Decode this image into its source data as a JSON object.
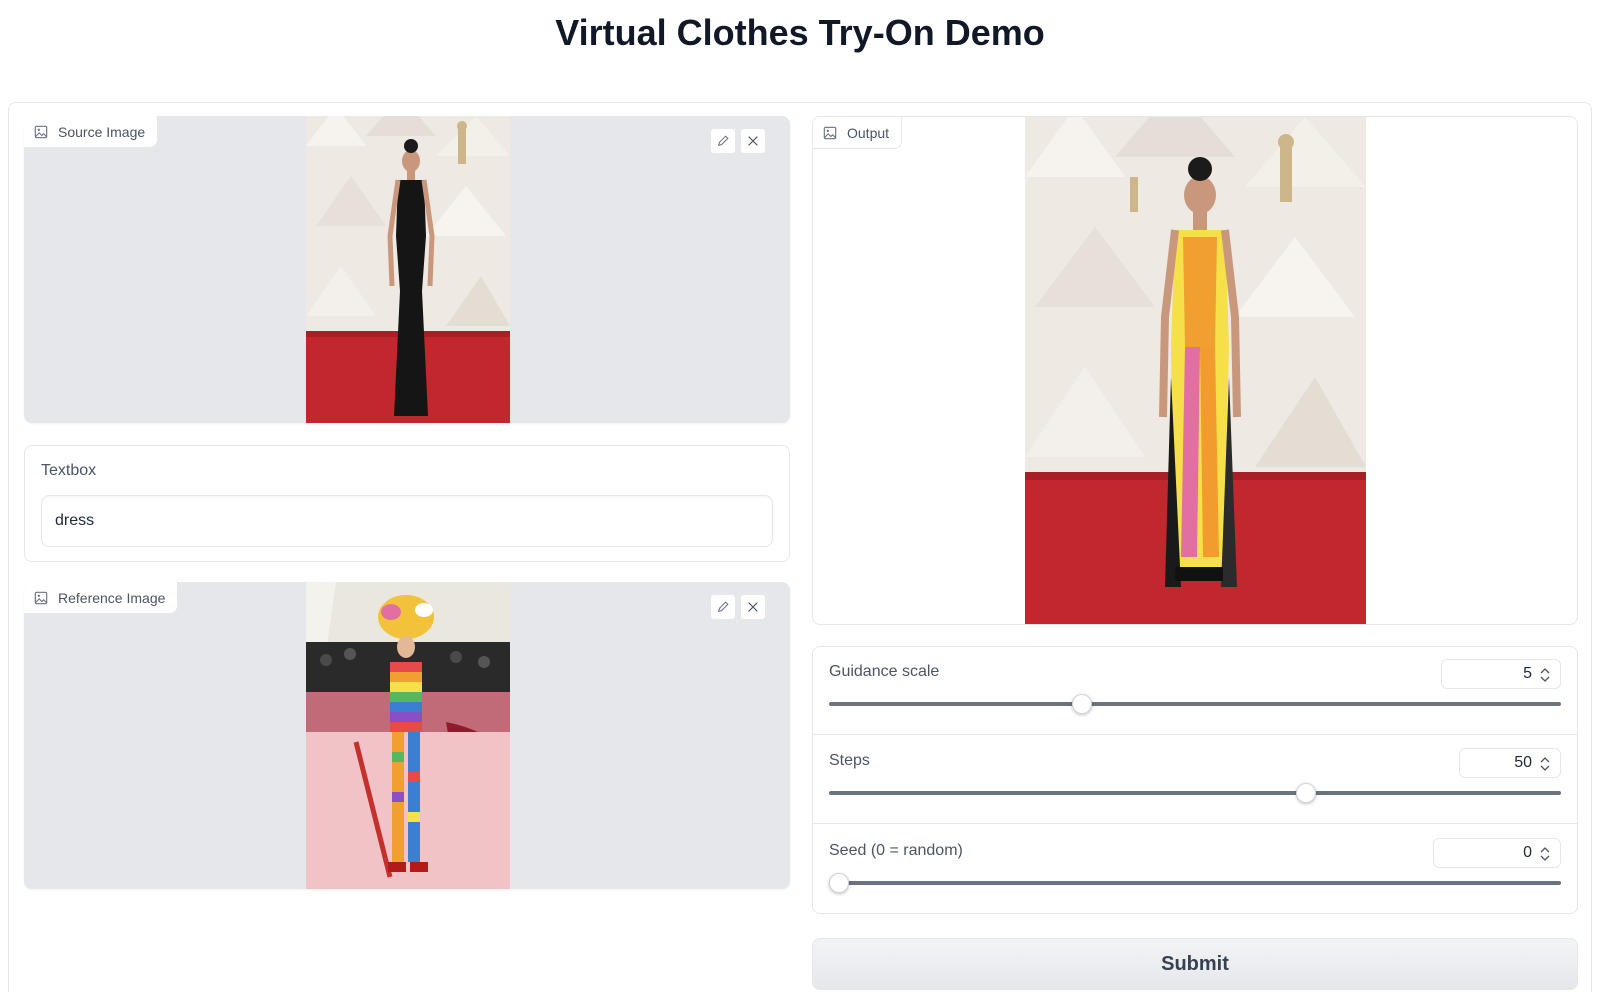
{
  "page": {
    "title": "Virtual Clothes Try-On Demo"
  },
  "source_image": {
    "label": "Source Image",
    "icon": "image-icon"
  },
  "textbox": {
    "label": "Textbox",
    "value": "dress"
  },
  "reference_image": {
    "label": "Reference Image",
    "icon": "image-icon"
  },
  "output": {
    "label": "Output",
    "icon": "image-icon"
  },
  "sliders": {
    "guidance": {
      "label": "Guidance scale",
      "value": "5",
      "fraction": 0.34
    },
    "steps": {
      "label": "Steps",
      "value": "50",
      "fraction": 0.654
    },
    "seed": {
      "label": "Seed (0 = random)",
      "value": "0",
      "fraction": 0.0
    }
  },
  "submit": {
    "label": "Submit"
  },
  "colors": {
    "accent": "#e5e7eb",
    "carpet": "#c0282d",
    "track": "#6b7280"
  }
}
